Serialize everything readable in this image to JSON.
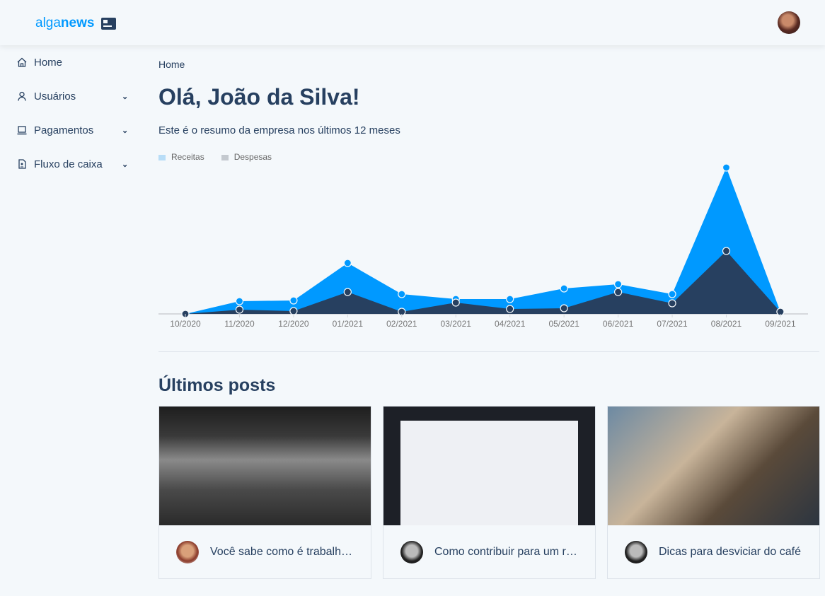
{
  "header": {
    "logo_light": "alga",
    "logo_bold": "news"
  },
  "sidebar": {
    "items": [
      {
        "label": "Home",
        "icon": "home-icon"
      },
      {
        "label": "Usuários",
        "icon": "user-icon"
      },
      {
        "label": "Pagamentos",
        "icon": "laptop-icon"
      },
      {
        "label": "Fluxo de caixa",
        "icon": "document-icon"
      }
    ]
  },
  "main": {
    "breadcrumb": "Home",
    "title": "Olá, João da Silva!",
    "subtitle": "Este é o resumo da empresa nos últimos 12 meses",
    "posts_title": "Últimos posts"
  },
  "chart_data": {
    "type": "area",
    "categories": [
      "10/2020",
      "11/2020",
      "12/2020",
      "01/2021",
      "02/2021",
      "03/2021",
      "04/2021",
      "05/2021",
      "06/2021",
      "07/2021",
      "08/2021",
      "09/2021"
    ],
    "series": [
      {
        "name": "Receitas",
        "color": "#0099ff",
        "values": [
          0,
          18,
          19,
          72,
          28,
          21,
          21,
          36,
          42,
          28,
          207,
          3
        ]
      },
      {
        "name": "Despesas",
        "color": "#274060",
        "values": [
          0,
          6,
          4,
          31,
          3,
          16,
          7,
          8,
          31,
          15,
          89,
          3
        ]
      }
    ],
    "legend_colors": [
      "#b8ddf7",
      "#c4c9cf"
    ],
    "ylim": [
      0,
      214
    ],
    "legend": "top-left"
  },
  "posts": [
    {
      "title": "Você sabe como é trabalh…"
    },
    {
      "title": "Como contribuir para um r…"
    },
    {
      "title": "Dicas para desviciar do café"
    }
  ]
}
